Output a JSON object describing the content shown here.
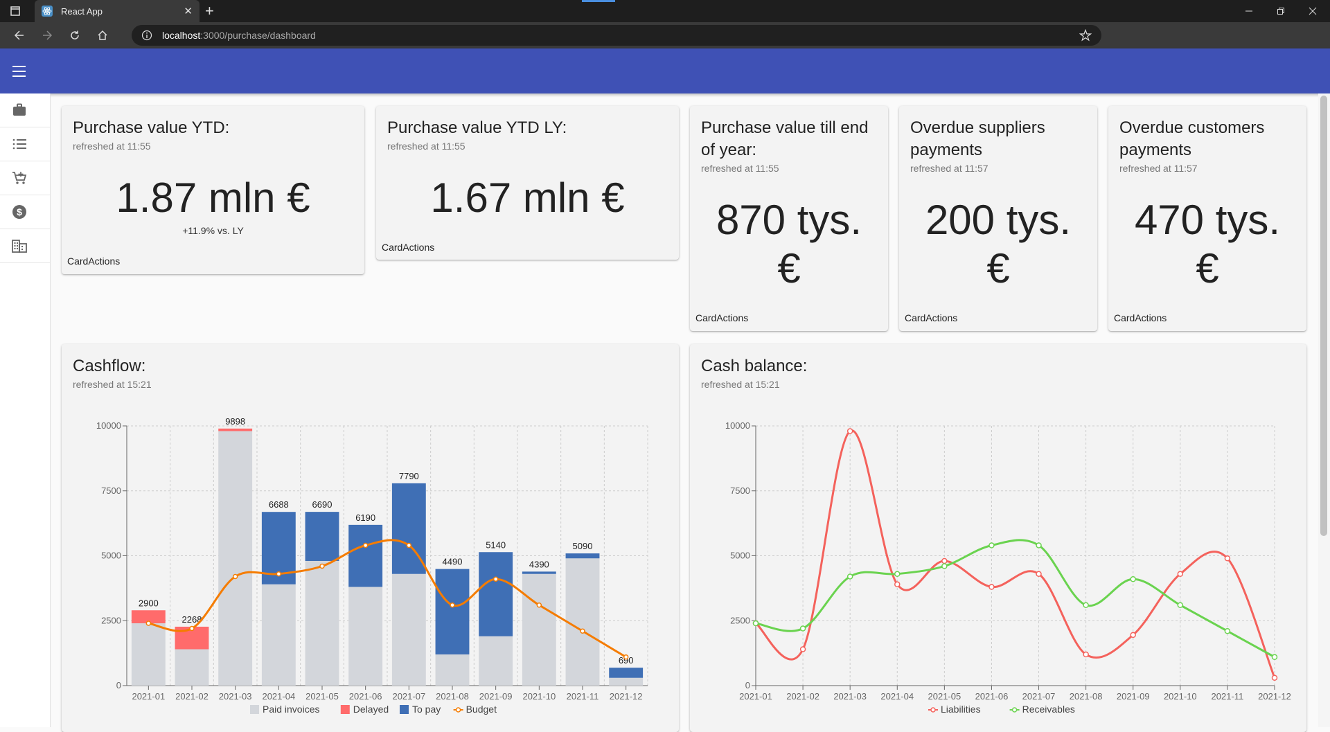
{
  "browser": {
    "tab_title": "React App",
    "url_host": "localhost",
    "url_path": ":3000/purchase/dashboard",
    "tab_close": "✕",
    "new_tab": "+"
  },
  "cards": {
    "ytd": {
      "title": "Purchase value YTD:",
      "refreshed": "refreshed at 11:55",
      "value": "1.87 mln €",
      "note": "+11.9% vs. LY",
      "actions": "CardActions"
    },
    "ytd_ly": {
      "title": "Purchase value YTD LY:",
      "refreshed": "refreshed at 11:55",
      "value": "1.67 mln €",
      "actions": "CardActions"
    },
    "till_end": {
      "title_line1": "Purchase value till end",
      "title_line2": "of year:",
      "refreshed": "refreshed at 11:55",
      "value_line1": "870 tys.",
      "value_line2": "€",
      "actions": "CardActions"
    },
    "overdue_suppliers": {
      "title_line1": "Overdue suppliers",
      "title_line2": "payments",
      "refreshed": "refreshed at 11:57",
      "value_line1": "200 tys.",
      "value_line2": "€",
      "actions": "CardActions"
    },
    "overdue_customers": {
      "title_line1": "Overdue customers",
      "title_line2": "payments",
      "refreshed": "refreshed at 11:57",
      "value_line1": "470 tys.",
      "value_line2": "€",
      "actions": "CardActions"
    }
  },
  "cashflow_card": {
    "title": "Cashflow:",
    "refreshed": "refreshed at 15:21"
  },
  "cashbalance_card": {
    "title": "Cash balance:",
    "refreshed": "refreshed at 15:21"
  },
  "chart_data": [
    {
      "type": "bar",
      "stacked": true,
      "categories": [
        "2021-01",
        "2021-02",
        "2021-03",
        "2021-04",
        "2021-05",
        "2021-06",
        "2021-07",
        "2021-08",
        "2021-09",
        "2021-10",
        "2021-11",
        "2021-12"
      ],
      "series": [
        {
          "name": "Paid invoices",
          "color": "#d3d6db",
          "values": [
            2400,
            1400,
            9800,
            3900,
            4800,
            3800,
            4300,
            1200,
            1900,
            4300,
            4900,
            300
          ]
        },
        {
          "name": "Delayed",
          "color": "#ff6b6b",
          "values": [
            500,
            868,
            98,
            0,
            0,
            0,
            0,
            0,
            0,
            0,
            0,
            0
          ]
        },
        {
          "name": "To pay",
          "color": "#3f6fb5",
          "values": [
            0,
            0,
            0,
            2788,
            1890,
            2390,
            3490,
            3290,
            3240,
            90,
            190,
            390
          ]
        },
        {
          "name": "Budget",
          "type": "line",
          "color": "#f57c00",
          "values": [
            2400,
            2200,
            4200,
            4300,
            4600,
            5400,
            5400,
            3100,
            4100,
            3100,
            2100,
            1100
          ]
        }
      ],
      "labels": [
        "2900",
        "2268",
        "9898",
        "6688",
        "6690",
        "6190",
        "7790",
        "4490",
        "5140",
        "4390",
        "5090",
        "690"
      ],
      "yticks": [
        0,
        2500,
        5000,
        7500,
        10000
      ],
      "ylim": [
        0,
        10000
      ],
      "grid": true,
      "legend": "bottom"
    },
    {
      "type": "line",
      "categories": [
        "2021-01",
        "2021-02",
        "2021-03",
        "2021-04",
        "2021-05",
        "2021-06",
        "2021-07",
        "2021-08",
        "2021-09",
        "2021-10",
        "2021-11",
        "2021-12"
      ],
      "series": [
        {
          "name": "Liabilities",
          "color": "#f4625c",
          "values": [
            2400,
            1400,
            9800,
            3900,
            4800,
            3800,
            4300,
            1200,
            1950,
            4300,
            4900,
            300
          ]
        },
        {
          "name": "Receivables",
          "color": "#6ad34f",
          "values": [
            2400,
            2200,
            4200,
            4300,
            4600,
            5400,
            5400,
            3100,
            4100,
            3100,
            2100,
            1100
          ]
        }
      ],
      "yticks": [
        0,
        2500,
        5000,
        7500,
        10000
      ],
      "ylim": [
        0,
        10000
      ],
      "grid": true,
      "legend": "bottom"
    }
  ]
}
